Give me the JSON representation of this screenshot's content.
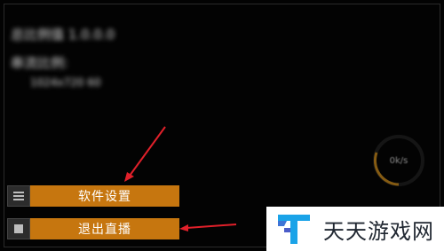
{
  "stream_info": {
    "line1": "总比例值  1.0.0.0",
    "line2": "串流比例:",
    "line3": "1024x720 60"
  },
  "speed_indicator": {
    "value": "0k/s"
  },
  "menu": {
    "items": [
      {
        "label": "软件设置",
        "icon": "hamburger-menu-icon"
      },
      {
        "label": "退出直播",
        "icon": "stop-square-icon"
      }
    ]
  },
  "watermark": {
    "text": "天天游戏网"
  },
  "colors": {
    "button_bg": "#c6760f",
    "arrow": "#e0202a",
    "dial_ring": "#d08a10"
  }
}
